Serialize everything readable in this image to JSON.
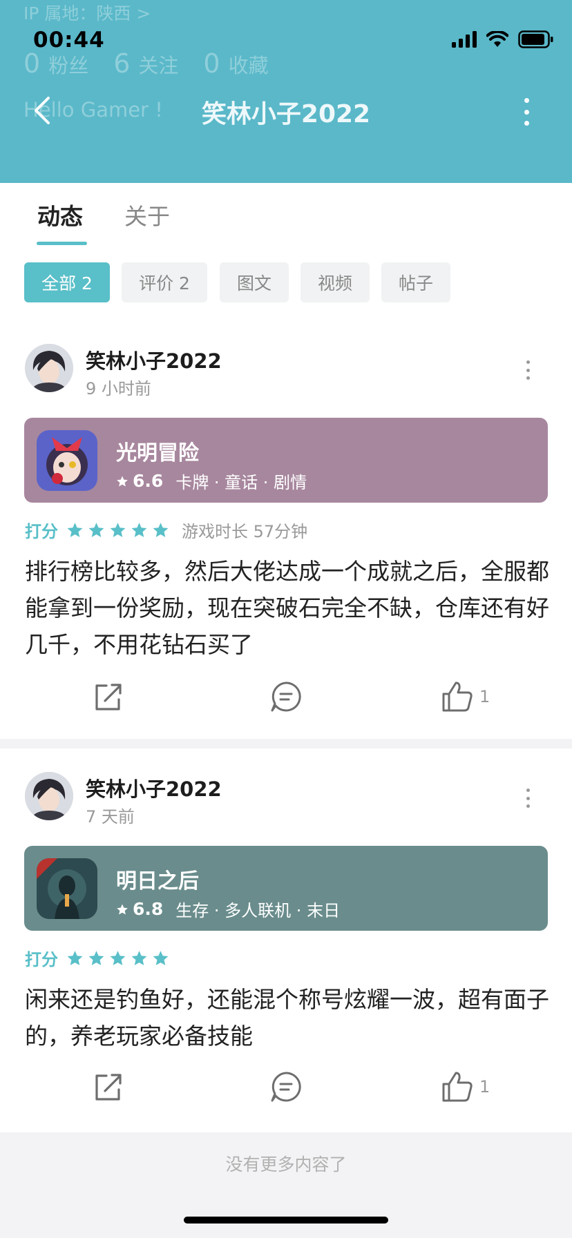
{
  "status_bar": {
    "time": "00:44"
  },
  "profile_ghost": {
    "ip_location": "IP 属地：陕西 >",
    "stats": [
      {
        "num": "0",
        "label": "粉丝"
      },
      {
        "num": "6",
        "label": "关注"
      },
      {
        "num": "0",
        "label": "收藏"
      }
    ],
    "bio": "Hello Gamer !"
  },
  "nav": {
    "title": "笑林小子2022"
  },
  "tabs": [
    {
      "label": "动态",
      "active": true
    },
    {
      "label": "关于",
      "active": false
    }
  ],
  "filters": [
    {
      "label": "全部 2",
      "active": true
    },
    {
      "label": "评价 2",
      "active": false
    },
    {
      "label": "图文",
      "active": false
    },
    {
      "label": "视频",
      "active": false
    },
    {
      "label": "帖子",
      "active": false
    }
  ],
  "posts": [
    {
      "username": "笑林小子2022",
      "time": "9 小时前",
      "game": {
        "name": "光明冒险",
        "score": "6.6",
        "tags": "卡牌 · 童话 · 剧情",
        "bg_color": "#a7879e"
      },
      "rating_label": "打分",
      "stars": 5,
      "playtime": "游戏时长 57分钟",
      "review": "排行榜比较多，然后大佬达成一个成就之后，全服都能拿到一份奖励，现在突破石完全不缺，仓库还有好几千，不用花钻石买了",
      "likes": "1"
    },
    {
      "username": "笑林小子2022",
      "time": "7 天前",
      "game": {
        "name": "明日之后",
        "score": "6.8",
        "tags": "生存 · 多人联机 · 末日",
        "bg_color": "#6a8c8c"
      },
      "rating_label": "打分",
      "stars": 5,
      "playtime": "",
      "review": "闲来还是钓鱼好，还能混个称号炫耀一波，超有面子的，养老玩家必备技能",
      "likes": "1"
    }
  ],
  "footer": {
    "no_more": "没有更多内容了"
  },
  "colors": {
    "header": "#5ab8c9",
    "accent": "#59bfc8"
  }
}
